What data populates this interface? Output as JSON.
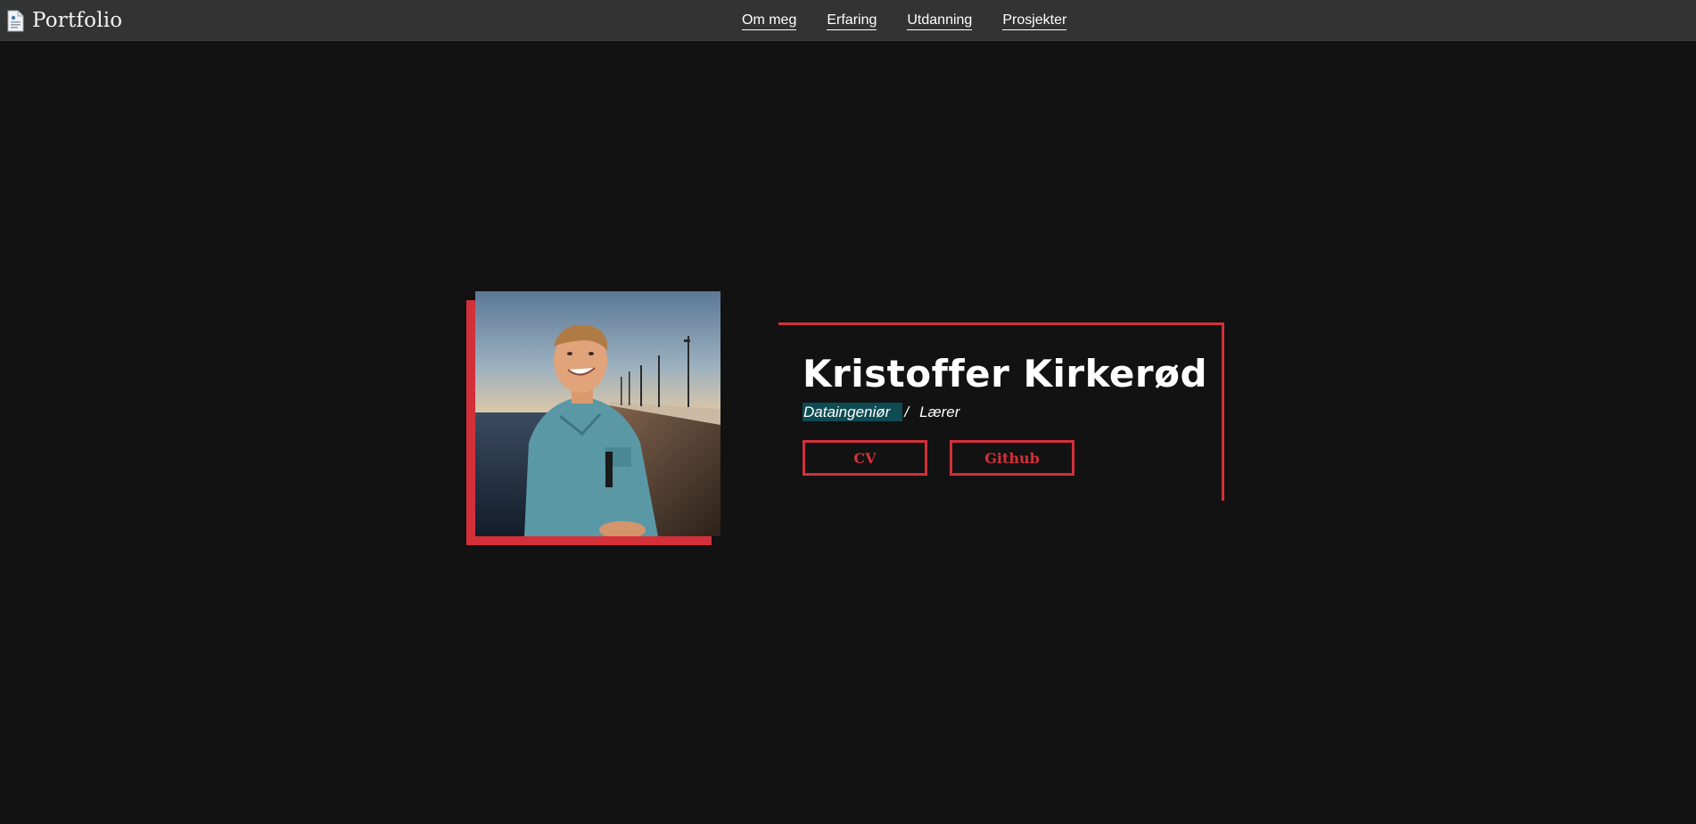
{
  "navbar": {
    "brand": "Portfolio",
    "brand_icon": "document-icon",
    "links": [
      {
        "label": "Om meg"
      },
      {
        "label": "Erfaring"
      },
      {
        "label": "Utdanning"
      },
      {
        "label": "Prosjekter"
      }
    ]
  },
  "hero": {
    "name": "Kristoffer Kirkerød",
    "roles": {
      "primary": "Dataingeniør",
      "separator": "/",
      "secondary": "Lærer"
    },
    "buttons": {
      "cv_label": "CV",
      "github_label": "Github"
    }
  },
  "colors": {
    "background": "#121212",
    "navbar": "#333333",
    "accent": "#d3303a",
    "role_highlight": "#0e4b52",
    "text": "#ffffff"
  }
}
